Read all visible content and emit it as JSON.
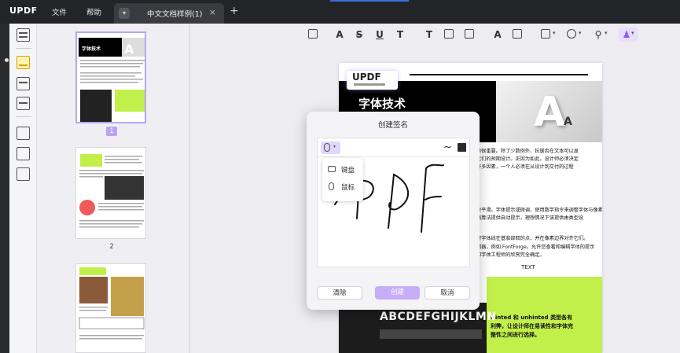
{
  "app": {
    "logo_main": "UPDF",
    "menu": [
      "文件",
      "帮助"
    ],
    "tab_label": "中文文档样例(1)",
    "tab_close": "×",
    "tab_add": "+"
  },
  "thumbnails": [
    {
      "page": "1",
      "title": "字体技术",
      "selected": true
    },
    {
      "page": "2",
      "title": "",
      "selected": false
    },
    {
      "page": "",
      "title": "",
      "selected": false
    }
  ],
  "document": {
    "badge": "UPDF",
    "title": "字体技术",
    "text_lines": [
      "读很重要。除了少数例外，抗锯齿在文本可以显",
      "它们的预期设计。正因为如此，设计师必须决定",
      "许多因素，一个人必须在从设计到交付的过程",
      "更平滑。字体提示或微调，使用数字指令来调整字体与像素",
      "器算法提供自动提示，理想情况下该提供由类型设",
      "将字体线在基准部取的点，并在像素边界对齐它们。",
      "辑器，例如 FontForge。允许您查看和编辑字体的提示",
      "和字体工程师的欣赏完全确定。"
    ],
    "caption": "TEXT",
    "green_text": "Hinted 和 unhinted 类型各有利弊，让设计师在易读性和字体完整性之间进行选择。",
    "sample_letters": "ABCDEFGHIJKLMN"
  },
  "dialog": {
    "title": "创建签名",
    "dropdown_items": [
      "键盘",
      "鼠标"
    ],
    "buttons": {
      "clear": "清除",
      "create": "创建",
      "cancel": "取消"
    },
    "ink_color": "#2a2a2a"
  }
}
